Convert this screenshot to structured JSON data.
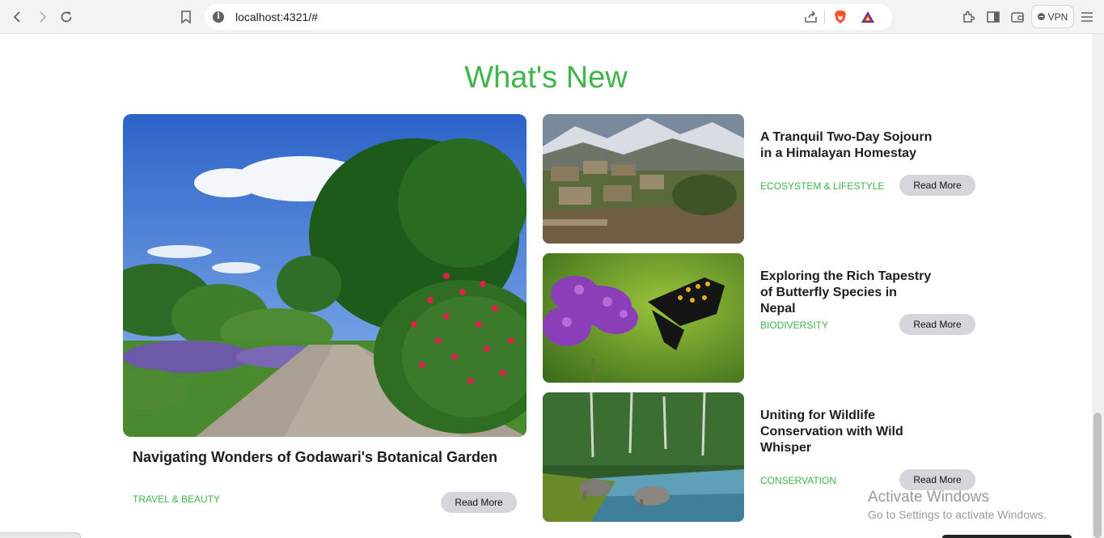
{
  "browser": {
    "url": "localhost:4321/#",
    "vpn_label": "VPN"
  },
  "section": {
    "heading": "What's New"
  },
  "featured": {
    "title": "Navigating Wonders of Godawari's Botanical Garden",
    "category": "TRAVEL & BEAUTY",
    "button": "Read More"
  },
  "cards": [
    {
      "title": "A Tranquil Two-Day Sojourn in a Himalayan Homestay",
      "category": "ECOSYSTEM & LIFESTYLE",
      "button": "Read More"
    },
    {
      "title": "Exploring the Rich Tapestry of Butterfly Species in Nepal",
      "category": "BIODIVERSITY",
      "button": "Read More"
    },
    {
      "title": "Uniting for Wildlife Conservation with Wild Whisper",
      "category": "CONSERVATION",
      "button": "Read More"
    }
  ],
  "watermark": {
    "line1": "Activate Windows",
    "line2": "Go to Settings to activate Windows."
  },
  "colors": {
    "accent": "#3fb54a",
    "button_bg": "#d4d6dc"
  }
}
